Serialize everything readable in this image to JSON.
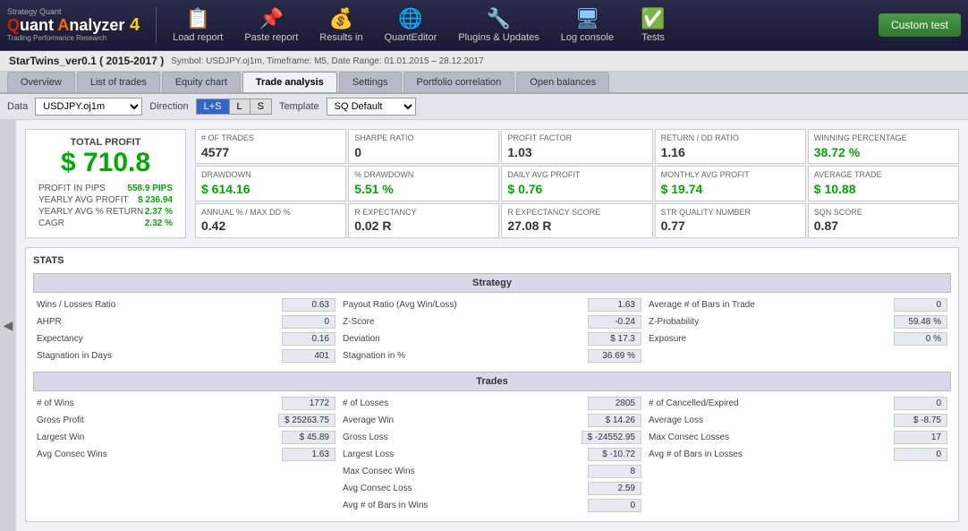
{
  "app": {
    "logo_line1": "Strategy Quant",
    "logo_main": "Quant Analyzer",
    "logo_num": "4",
    "logo_sub": "Trading Performance   Research"
  },
  "toolbar": {
    "buttons": [
      {
        "id": "load-report",
        "icon": "📋",
        "label": "Load report"
      },
      {
        "id": "paste-report",
        "icon": "📌",
        "label": "Paste report"
      },
      {
        "id": "results-in",
        "icon": "💰",
        "label": "Results in"
      },
      {
        "id": "quant-editor",
        "icon": "🌐",
        "label": "QuantEditor"
      },
      {
        "id": "plugins",
        "icon": "🔧",
        "label": "Plugins & Updates"
      },
      {
        "id": "log-console",
        "icon": "🖥",
        "label": "Log console"
      },
      {
        "id": "tests",
        "icon": "✅",
        "label": "Tests"
      }
    ],
    "custom_label": "Custom test"
  },
  "info_bar": {
    "strategy_name": "StarTwins_ver0.1 ( 2015-2017 )",
    "meta": "Symbol: USDJPY.oj1m, Timeframe: M5, Date Range: 01.01.2015 – 28.12.2017"
  },
  "tabs": [
    {
      "id": "overview",
      "label": "Overview",
      "active": false
    },
    {
      "id": "list-of-trades",
      "label": "List of trades",
      "active": false
    },
    {
      "id": "equity-chart",
      "label": "Equity chart",
      "active": false
    },
    {
      "id": "trade-analysis",
      "label": "Trade analysis",
      "active": true
    },
    {
      "id": "settings",
      "label": "Settings",
      "active": false
    },
    {
      "id": "portfolio-correlation",
      "label": "Portfolio correlation",
      "active": false
    },
    {
      "id": "open-balances",
      "label": "Open balances",
      "active": false
    }
  ],
  "filter_bar": {
    "data_label": "Data",
    "data_value": "USDJPY.oj1m",
    "direction_label": "Direction",
    "direction_options": [
      "L+S",
      "L",
      "S"
    ],
    "direction_active": "L+S",
    "template_label": "Template",
    "template_value": "SQ Default"
  },
  "summary": {
    "total_profit_label": "TOTAL PROFIT",
    "total_profit_value": "$ 710.8",
    "sub_stats": [
      {
        "label": "PROFIT IN PIPS",
        "value": "558.9 PIPS"
      },
      {
        "label": "YEARLY AVG PROFIT",
        "value": "$ 236.94"
      },
      {
        "label": "YEARLY AVG % RETURN",
        "value": "2.37 %"
      },
      {
        "label": "CAGR",
        "value": "2.32 %"
      }
    ]
  },
  "metrics": [
    {
      "label": "# OF TRADES",
      "value": "4577"
    },
    {
      "label": "SHARPE RATIO",
      "value": "0"
    },
    {
      "label": "PROFIT FACTOR",
      "value": "1.03"
    },
    {
      "label": "RETURN / DD RATIO",
      "value": "1.16"
    },
    {
      "label": "WINNING PERCENTAGE",
      "value": "38.72 %"
    },
    {
      "label": "DRAWDOWN",
      "value": "$ 614.16"
    },
    {
      "label": "% DRAWDOWN",
      "value": "5.51 %"
    },
    {
      "label": "DAILY AVG PROFIT",
      "value": "$ 0.76"
    },
    {
      "label": "MONTHLY AVG PROFIT",
      "value": "$ 19.74"
    },
    {
      "label": "AVERAGE TRADE",
      "value": "$ 10.88"
    },
    {
      "label": "ANNUAL % / MAX DD %",
      "value": "0.42"
    },
    {
      "label": "R EXPECTANCY",
      "value": "0.02 R"
    },
    {
      "label": "R EXPECTANCY SCORE",
      "value": "27.08 R"
    },
    {
      "label": "STR QUALITY NUMBER",
      "value": "0.77"
    },
    {
      "label": "SQN SCORE",
      "value": "0.87"
    }
  ],
  "stats_label": "STATS",
  "strategy_section": {
    "header": "Strategy",
    "left": [
      {
        "label": "Wins / Losses Ratio",
        "value": "0.63"
      },
      {
        "label": "AHPR",
        "value": "0"
      },
      {
        "label": "Expectancy",
        "value": "0.16"
      },
      {
        "label": "Stagnation in Days",
        "value": "401"
      }
    ],
    "middle": [
      {
        "label": "Payout Ratio (Avg Win/Loss)",
        "value": "1.63"
      },
      {
        "label": "Z-Score",
        "value": "-0.24"
      },
      {
        "label": "Deviation",
        "value": "$ 17.3"
      },
      {
        "label": "Stagnation in %",
        "value": "36.69 %"
      }
    ],
    "right": [
      {
        "label": "Average # of Bars in Trade",
        "value": "0"
      },
      {
        "label": "Z-Probability",
        "value": "59.48 %"
      },
      {
        "label": "Exposure",
        "value": "0 %"
      },
      {
        "label": "",
        "value": ""
      }
    ]
  },
  "trades_section": {
    "header": "Trades",
    "left": [
      {
        "label": "Gross Profit",
        "value": "$ 25263.75"
      },
      {
        "label": "Largest Win",
        "value": "$ 45.89"
      },
      {
        "label": "Avg Consec Wins",
        "value": "1.63"
      }
    ],
    "left_top": [
      {
        "label": "# of Wins",
        "value": "1772"
      },
      {
        "label": "Gross Profit",
        "value": "$ 25263.75"
      },
      {
        "label": "Largest Win",
        "value": "$ 45.89"
      },
      {
        "label": "Avg Consec Wins",
        "value": "1.63"
      }
    ],
    "middle": [
      {
        "label": "# of Losses",
        "value": "2805"
      },
      {
        "label": "Gross Loss",
        "value": "$ -24552.95"
      },
      {
        "label": "Largest Loss",
        "value": "$ -10.72"
      },
      {
        "label": "Avg Consec Loss",
        "value": "2.59"
      }
    ],
    "middle_header": [
      {
        "label": "# of Wins",
        "value": "1772"
      },
      {
        "label": "# of Losses",
        "value": "2805"
      }
    ],
    "right": [
      {
        "label": "# of Cancelled/Expired",
        "value": "0"
      },
      {
        "label": "Average Loss",
        "value": "$ -8.75"
      },
      {
        "label": "Max Consec Losses",
        "value": "17"
      },
      {
        "label": "Avg # of Bars in Losses",
        "value": "0"
      }
    ],
    "right_header": [
      {
        "label": "# of Cancelled/Expired",
        "value": "0"
      }
    ],
    "col1": [
      {
        "label": "# of Wins",
        "value": "1772"
      },
      {
        "label": "Gross Profit",
        "value": "$ 25263.75"
      },
      {
        "label": "Largest Win",
        "value": "$ 45.89"
      },
      {
        "label": "Avg Consec Wins",
        "value": "1.63"
      }
    ],
    "col2": [
      {
        "label": "# of Losses",
        "value": "2805"
      },
      {
        "label": "Average Win",
        "value": "$ 14.26"
      },
      {
        "label": "Gross Loss",
        "value": "$ -24552.95"
      },
      {
        "label": "Largest Loss",
        "value": "$ -10.72"
      },
      {
        "label": "Max Consec Wins",
        "value": "8"
      },
      {
        "label": "Avg Consec Loss",
        "value": "2.59"
      },
      {
        "label": "Avg # of Bars in Wins",
        "value": "0"
      }
    ],
    "col3": [
      {
        "label": "# of Cancelled/Expired",
        "value": "0"
      },
      {
        "label": "Average Loss",
        "value": "$ -8.75"
      },
      {
        "label": "Max Consec Losses",
        "value": "17"
      },
      {
        "label": "Avg # of Bars in Losses",
        "value": "0"
      }
    ]
  }
}
